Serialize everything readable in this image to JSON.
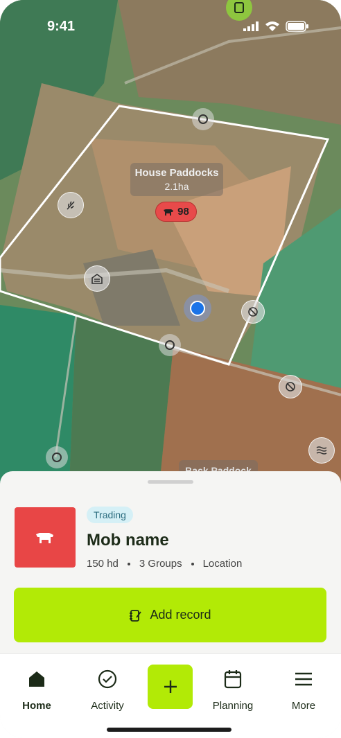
{
  "status_bar": {
    "time": "9:41"
  },
  "map": {
    "paddock": {
      "name": "House Paddocks",
      "area": "2.1ha",
      "animal_count": "98"
    },
    "secondary_label": "Back Paddock",
    "icons": [
      "notebook-icon",
      "wheat-icon",
      "shed-icon",
      "no-entry-icon",
      "water-icon"
    ]
  },
  "sheet": {
    "tag": "Trading",
    "title": "Mob name",
    "meta": {
      "head": "150 hd",
      "groups": "3 Groups",
      "location": "Location"
    },
    "add_record_label": "Add record"
  },
  "tabbar": {
    "items": [
      {
        "label": "Home",
        "icon": "home-icon",
        "active": true
      },
      {
        "label": "Activity",
        "icon": "check-circle-icon"
      },
      {
        "label": "",
        "icon": "plus-icon"
      },
      {
        "label": "Planning",
        "icon": "calendar-icon"
      },
      {
        "label": "More",
        "icon": "menu-icon"
      }
    ]
  },
  "colors": {
    "accent": "#b2ea06",
    "mob_tile": "#e84646",
    "badge": "#e84a4a"
  }
}
